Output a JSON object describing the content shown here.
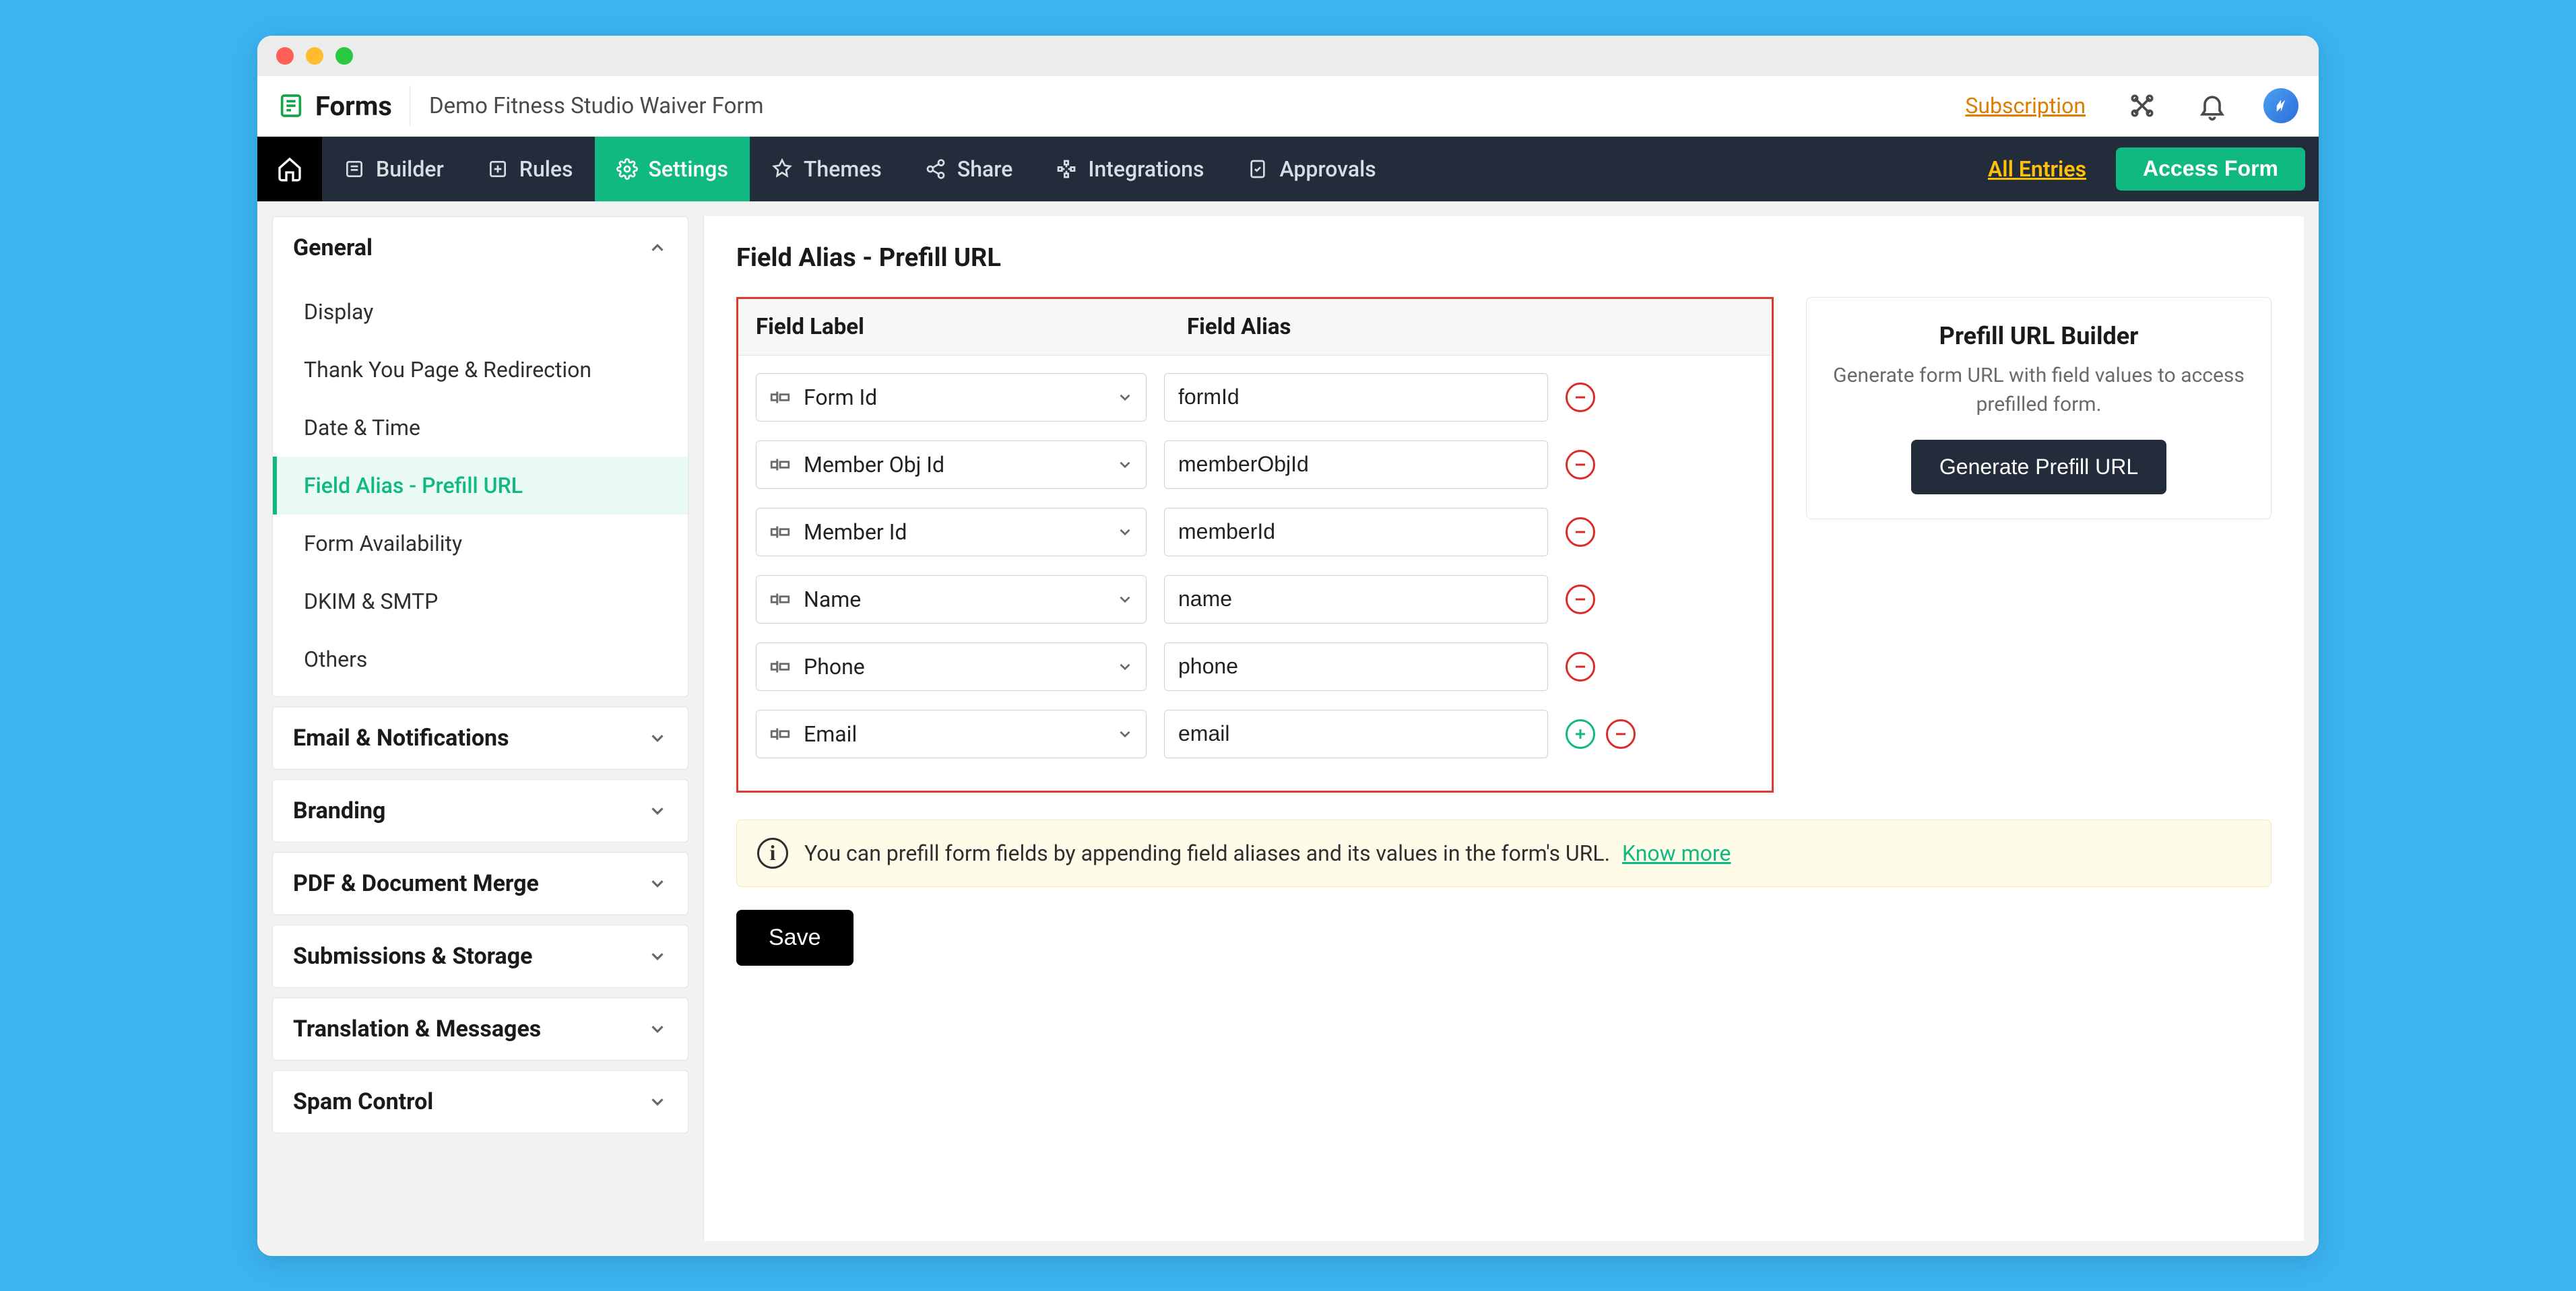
{
  "header": {
    "app_name": "Forms",
    "form_name": "Demo Fitness Studio Waiver Form",
    "subscription_label": "Subscription"
  },
  "nav": {
    "builder": "Builder",
    "rules": "Rules",
    "settings": "Settings",
    "themes": "Themes",
    "share": "Share",
    "integrations": "Integrations",
    "approvals": "Approvals",
    "all_entries": "All Entries",
    "access_form": "Access Form"
  },
  "sidebar": {
    "sections": {
      "general": {
        "title": "General",
        "items": [
          "Display",
          "Thank You Page & Redirection",
          "Date & Time",
          "Field Alias - Prefill URL",
          "Form Availability",
          "DKIM & SMTP",
          "Others"
        ],
        "active_index": 3
      },
      "email": {
        "title": "Email & Notifications"
      },
      "branding": {
        "title": "Branding"
      },
      "pdf": {
        "title": "PDF & Document Merge"
      },
      "submissions": {
        "title": "Submissions & Storage"
      },
      "translation": {
        "title": "Translation & Messages"
      },
      "spam": {
        "title": "Spam Control"
      }
    }
  },
  "page": {
    "title": "Field Alias - Prefill URL",
    "table": {
      "col_label": "Field Label",
      "col_alias": "Field Alias",
      "rows": [
        {
          "label": "Form Id",
          "alias": "formId",
          "last": false
        },
        {
          "label": "Member Obj Id",
          "alias": "memberObjId",
          "last": false
        },
        {
          "label": "Member Id",
          "alias": "memberId",
          "last": false
        },
        {
          "label": "Name",
          "alias": "name",
          "last": false
        },
        {
          "label": "Phone",
          "alias": "phone",
          "last": false
        },
        {
          "label": "Email",
          "alias": "email",
          "last": true
        }
      ]
    },
    "prefill": {
      "title": "Prefill URL Builder",
      "desc": "Generate form URL with field values to access prefilled form.",
      "button": "Generate Prefill URL"
    },
    "banner": {
      "text": "You can prefill form fields by appending field aliases and its values in the form's URL.",
      "know_more": "Know more"
    },
    "save": "Save"
  }
}
